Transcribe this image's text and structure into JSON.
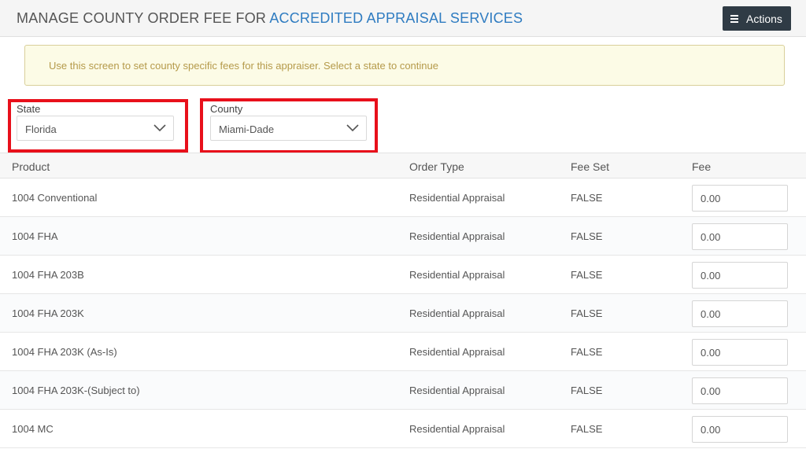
{
  "header": {
    "title_prefix": "MANAGE COUNTY ORDER FEE FOR ",
    "title_accent": "ACCREDITED APPRAISAL SERVICES",
    "actions_label": "Actions"
  },
  "info": {
    "message": "Use this screen to set county specific fees for this appraiser. Select a state to continue"
  },
  "filters": {
    "state_label": "State",
    "state_value": "Florida",
    "county_label": "County",
    "county_value": "Miami-Dade"
  },
  "table": {
    "columns": [
      "Product",
      "Order Type",
      "Fee Set",
      "Fee"
    ],
    "rows": [
      {
        "product": "1004 Conventional",
        "order_type": "Residential Appraisal",
        "fee_set": "FALSE",
        "fee": "0.00"
      },
      {
        "product": "1004 FHA",
        "order_type": "Residential Appraisal",
        "fee_set": "FALSE",
        "fee": "0.00"
      },
      {
        "product": "1004 FHA 203B",
        "order_type": "Residential Appraisal",
        "fee_set": "FALSE",
        "fee": "0.00"
      },
      {
        "product": "1004 FHA 203K",
        "order_type": "Residential Appraisal",
        "fee_set": "FALSE",
        "fee": "0.00"
      },
      {
        "product": "1004 FHA 203K (As-Is)",
        "order_type": "Residential Appraisal",
        "fee_set": "FALSE",
        "fee": "0.00"
      },
      {
        "product": "1004 FHA 203K-(Subject to)",
        "order_type": "Residential Appraisal",
        "fee_set": "FALSE",
        "fee": "0.00"
      },
      {
        "product": "1004 MC",
        "order_type": "Residential Appraisal",
        "fee_set": "FALSE",
        "fee": "0.00"
      }
    ]
  },
  "colors": {
    "accent": "#2f7cc1",
    "highlight": "#e8101b",
    "actions_bg": "#2f3b45"
  }
}
